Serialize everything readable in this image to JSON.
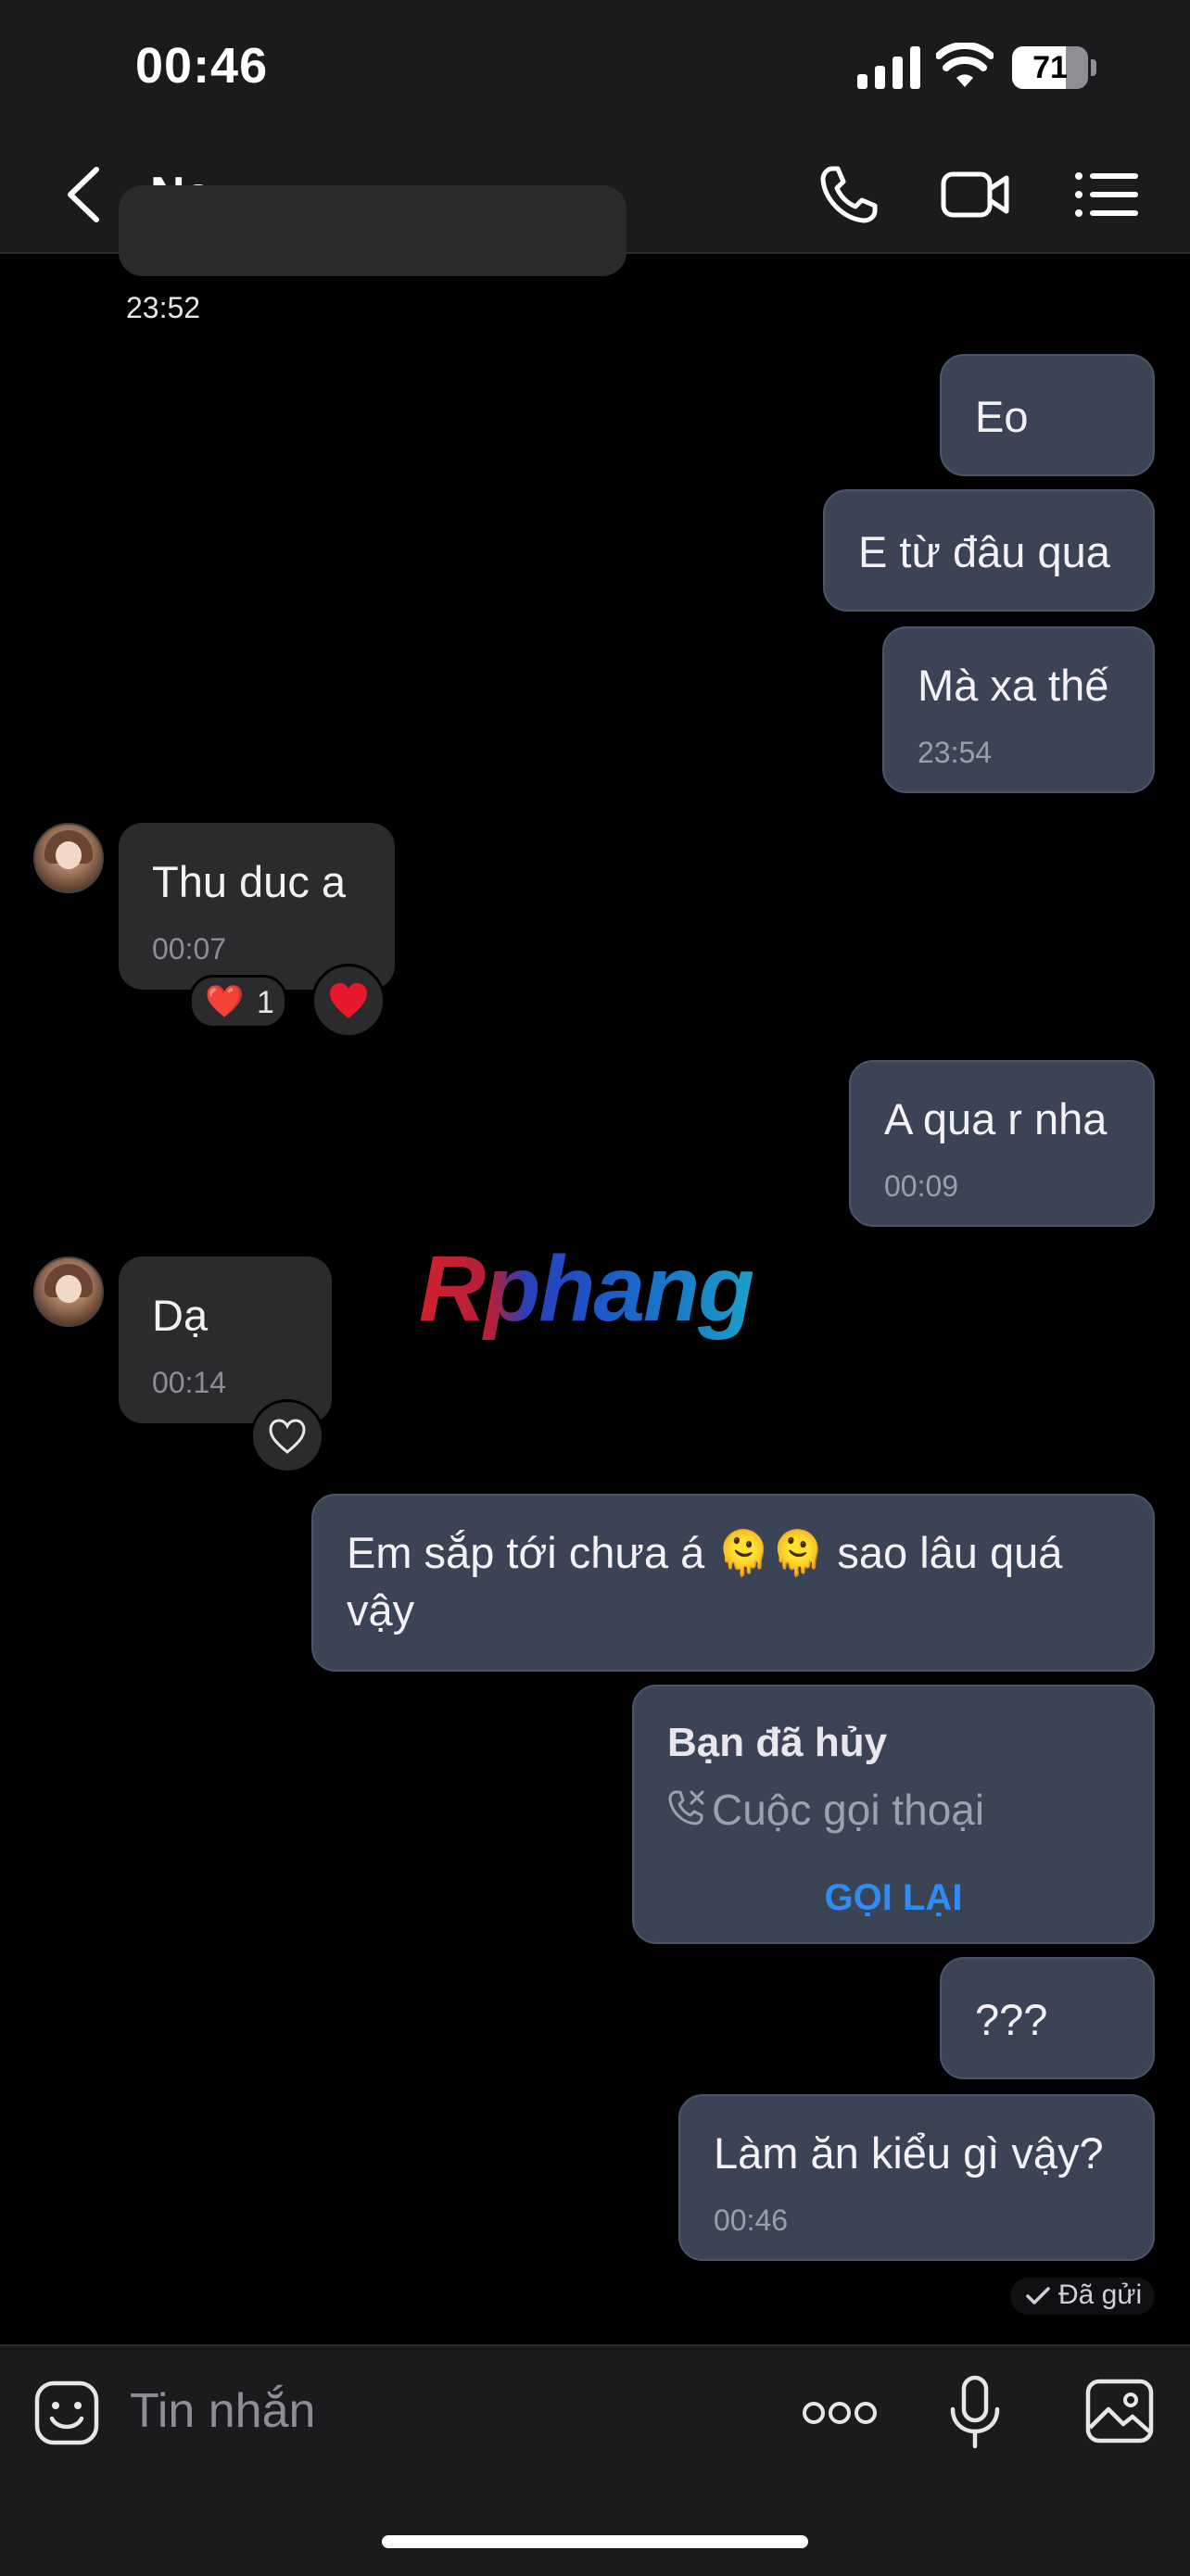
{
  "status_bar": {
    "time": "00:46",
    "battery_level": "71"
  },
  "header": {
    "contact_name": "Na",
    "icons": [
      "back-icon",
      "phone-icon",
      "video-call-icon",
      "menu-icon"
    ]
  },
  "conversation": {
    "prev_timestamp": "23:52",
    "messages": [
      {
        "side": "out",
        "text": "Eo"
      },
      {
        "side": "out",
        "text": "E từ đâu qua"
      },
      {
        "side": "out",
        "text": "Mà xa thế",
        "time": "23:54"
      },
      {
        "side": "in",
        "text": "Thu duc a",
        "time": "00:07",
        "reaction": "❤️",
        "reaction_count": "1"
      },
      {
        "side": "out",
        "text": "A qua r nha",
        "time": "00:09"
      },
      {
        "side": "in",
        "text": "Dạ",
        "time": "00:14"
      },
      {
        "side": "out",
        "text_line1": "Em sắp tới chưa á 🫠🫠 sao lâu quá",
        "text_line2": "vậy"
      },
      {
        "side": "out",
        "type": "call",
        "title": "Bạn đã hủy",
        "subtitle": "Cuộc gọi thoại",
        "action": "GỌI LẠI"
      },
      {
        "side": "out",
        "text": "???"
      },
      {
        "side": "out",
        "text": "Làm ăn kiểu gì vậy?",
        "time": "00:46"
      }
    ],
    "sent_status": "Đã gửi"
  },
  "watermark": "Rphang",
  "input_bar": {
    "placeholder": "Tin nhắn",
    "icons": [
      "emoji-icon",
      "more-icon",
      "microphone-icon",
      "image-icon"
    ]
  },
  "colors": {
    "outgoing_bubble": "#3a4455",
    "incoming_bubble": "#2b2b2d",
    "accent": "#2f8cf4",
    "heart": "#e8192c"
  }
}
